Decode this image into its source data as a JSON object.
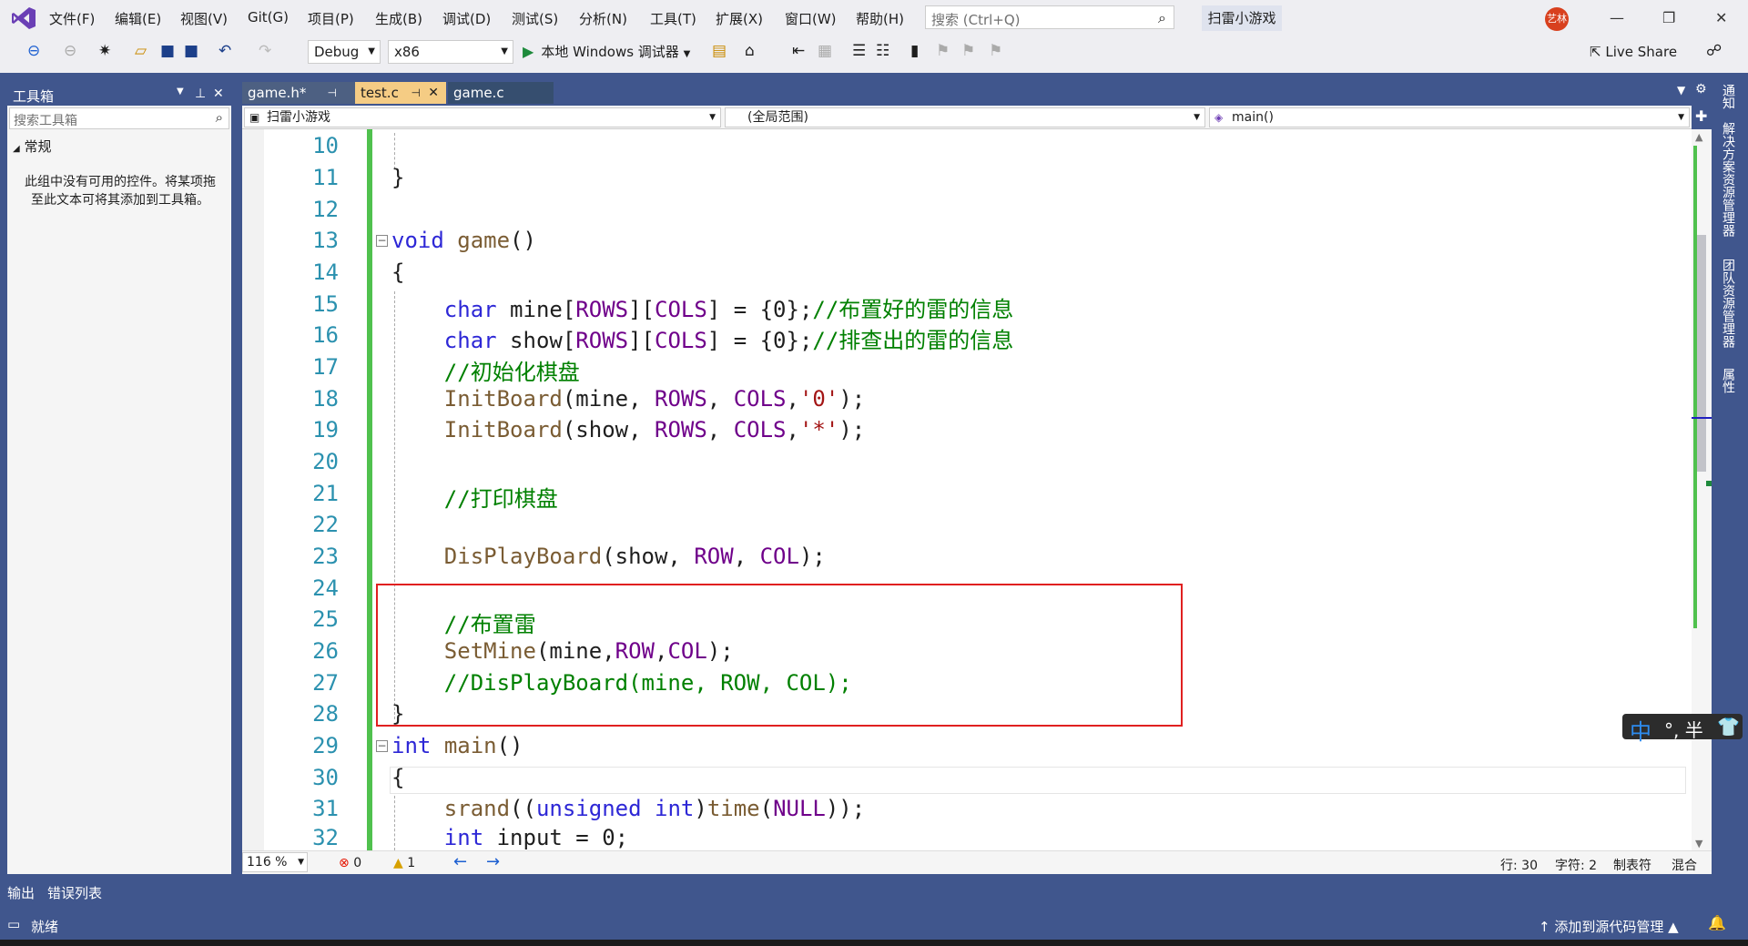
{
  "menu": {
    "items": [
      "文件(F)",
      "编辑(E)",
      "视图(V)",
      "Git(G)",
      "项目(P)",
      "生成(B)",
      "调试(D)",
      "测试(S)",
      "分析(N)",
      "工具(T)",
      "扩展(X)",
      "窗口(W)",
      "帮助(H)"
    ],
    "search_placeholder": "搜索 (Ctrl+Q)",
    "solution_name": "扫雷小游戏",
    "avatar_text": "艺林"
  },
  "toolbar": {
    "config": "Debug",
    "platform": "x86",
    "debugger": "本地 Windows 调试器",
    "live_share": "Live Share"
  },
  "toolbox": {
    "title": "工具箱",
    "search_placeholder": "搜索工具箱",
    "group": "常规",
    "empty_text": "此组中没有可用的控件。将某项拖至此文本可将其添加到工具箱。"
  },
  "tabs": [
    {
      "label": "game.h*",
      "active": false
    },
    {
      "label": "test.c",
      "active": true
    },
    {
      "label": "game.c",
      "active": false
    }
  ],
  "navbar": {
    "project": "扫雷小游戏",
    "scope": "(全局范围)",
    "member": "main()"
  },
  "code": {
    "lines": [
      {
        "no": "10",
        "text": ""
      },
      {
        "no": "11",
        "text": "}"
      },
      {
        "no": "12",
        "text": ""
      },
      {
        "no": "13",
        "text": "void game()"
      },
      {
        "no": "14",
        "text": "{"
      },
      {
        "no": "15",
        "text": "    char mine[ROWS][COLS] = {0};//布置好的雷的信息"
      },
      {
        "no": "16",
        "text": "    char show[ROWS][COLS] = {0};//排查出的雷的信息"
      },
      {
        "no": "17",
        "text": "    //初始化棋盘"
      },
      {
        "no": "18",
        "text": "    InitBoard(mine, ROWS, COLS,'0');"
      },
      {
        "no": "19",
        "text": "    InitBoard(show, ROWS, COLS,'*');"
      },
      {
        "no": "20",
        "text": ""
      },
      {
        "no": "21",
        "text": "    //打印棋盘"
      },
      {
        "no": "22",
        "text": ""
      },
      {
        "no": "23",
        "text": "    DisPlayBoard(show, ROW, COL);"
      },
      {
        "no": "24",
        "text": ""
      },
      {
        "no": "25",
        "text": "    //布置雷"
      },
      {
        "no": "26",
        "text": "    SetMine(mine,ROW,COL);"
      },
      {
        "no": "27",
        "text": "    //DisPlayBoard(mine, ROW, COL);"
      },
      {
        "no": "28",
        "text": "}"
      },
      {
        "no": "29",
        "text": "int main()"
      },
      {
        "no": "30",
        "text": "{"
      },
      {
        "no": "31",
        "text": "    srand((unsigned int)time(NULL));"
      },
      {
        "no": "32",
        "text": "    int input = 0;"
      }
    ]
  },
  "editor_status": {
    "zoom": "116 %",
    "errors": "0",
    "warnings": "1",
    "line": "行: 30",
    "char": "字符: 2",
    "tabs": "制表符",
    "eol": "混合"
  },
  "side_tabs": [
    "通知",
    "解决方案资源管理器",
    "团队资源管理器",
    "属性"
  ],
  "ime": {
    "lang": "中",
    "rest": "°, 半"
  },
  "bottom_tabs": [
    "输出",
    "错误列表"
  ],
  "status": {
    "text": "就绪",
    "scm": "↑ 添加到源代码管理 ▲"
  },
  "colors": {
    "frame": "#40568d",
    "active_tab": "#f5cc84",
    "change_bar": "#50c14e",
    "keyword": "#2d27d6",
    "comment": "#008000",
    "macro": "#6f008a",
    "highlight_box": "#e02020"
  }
}
